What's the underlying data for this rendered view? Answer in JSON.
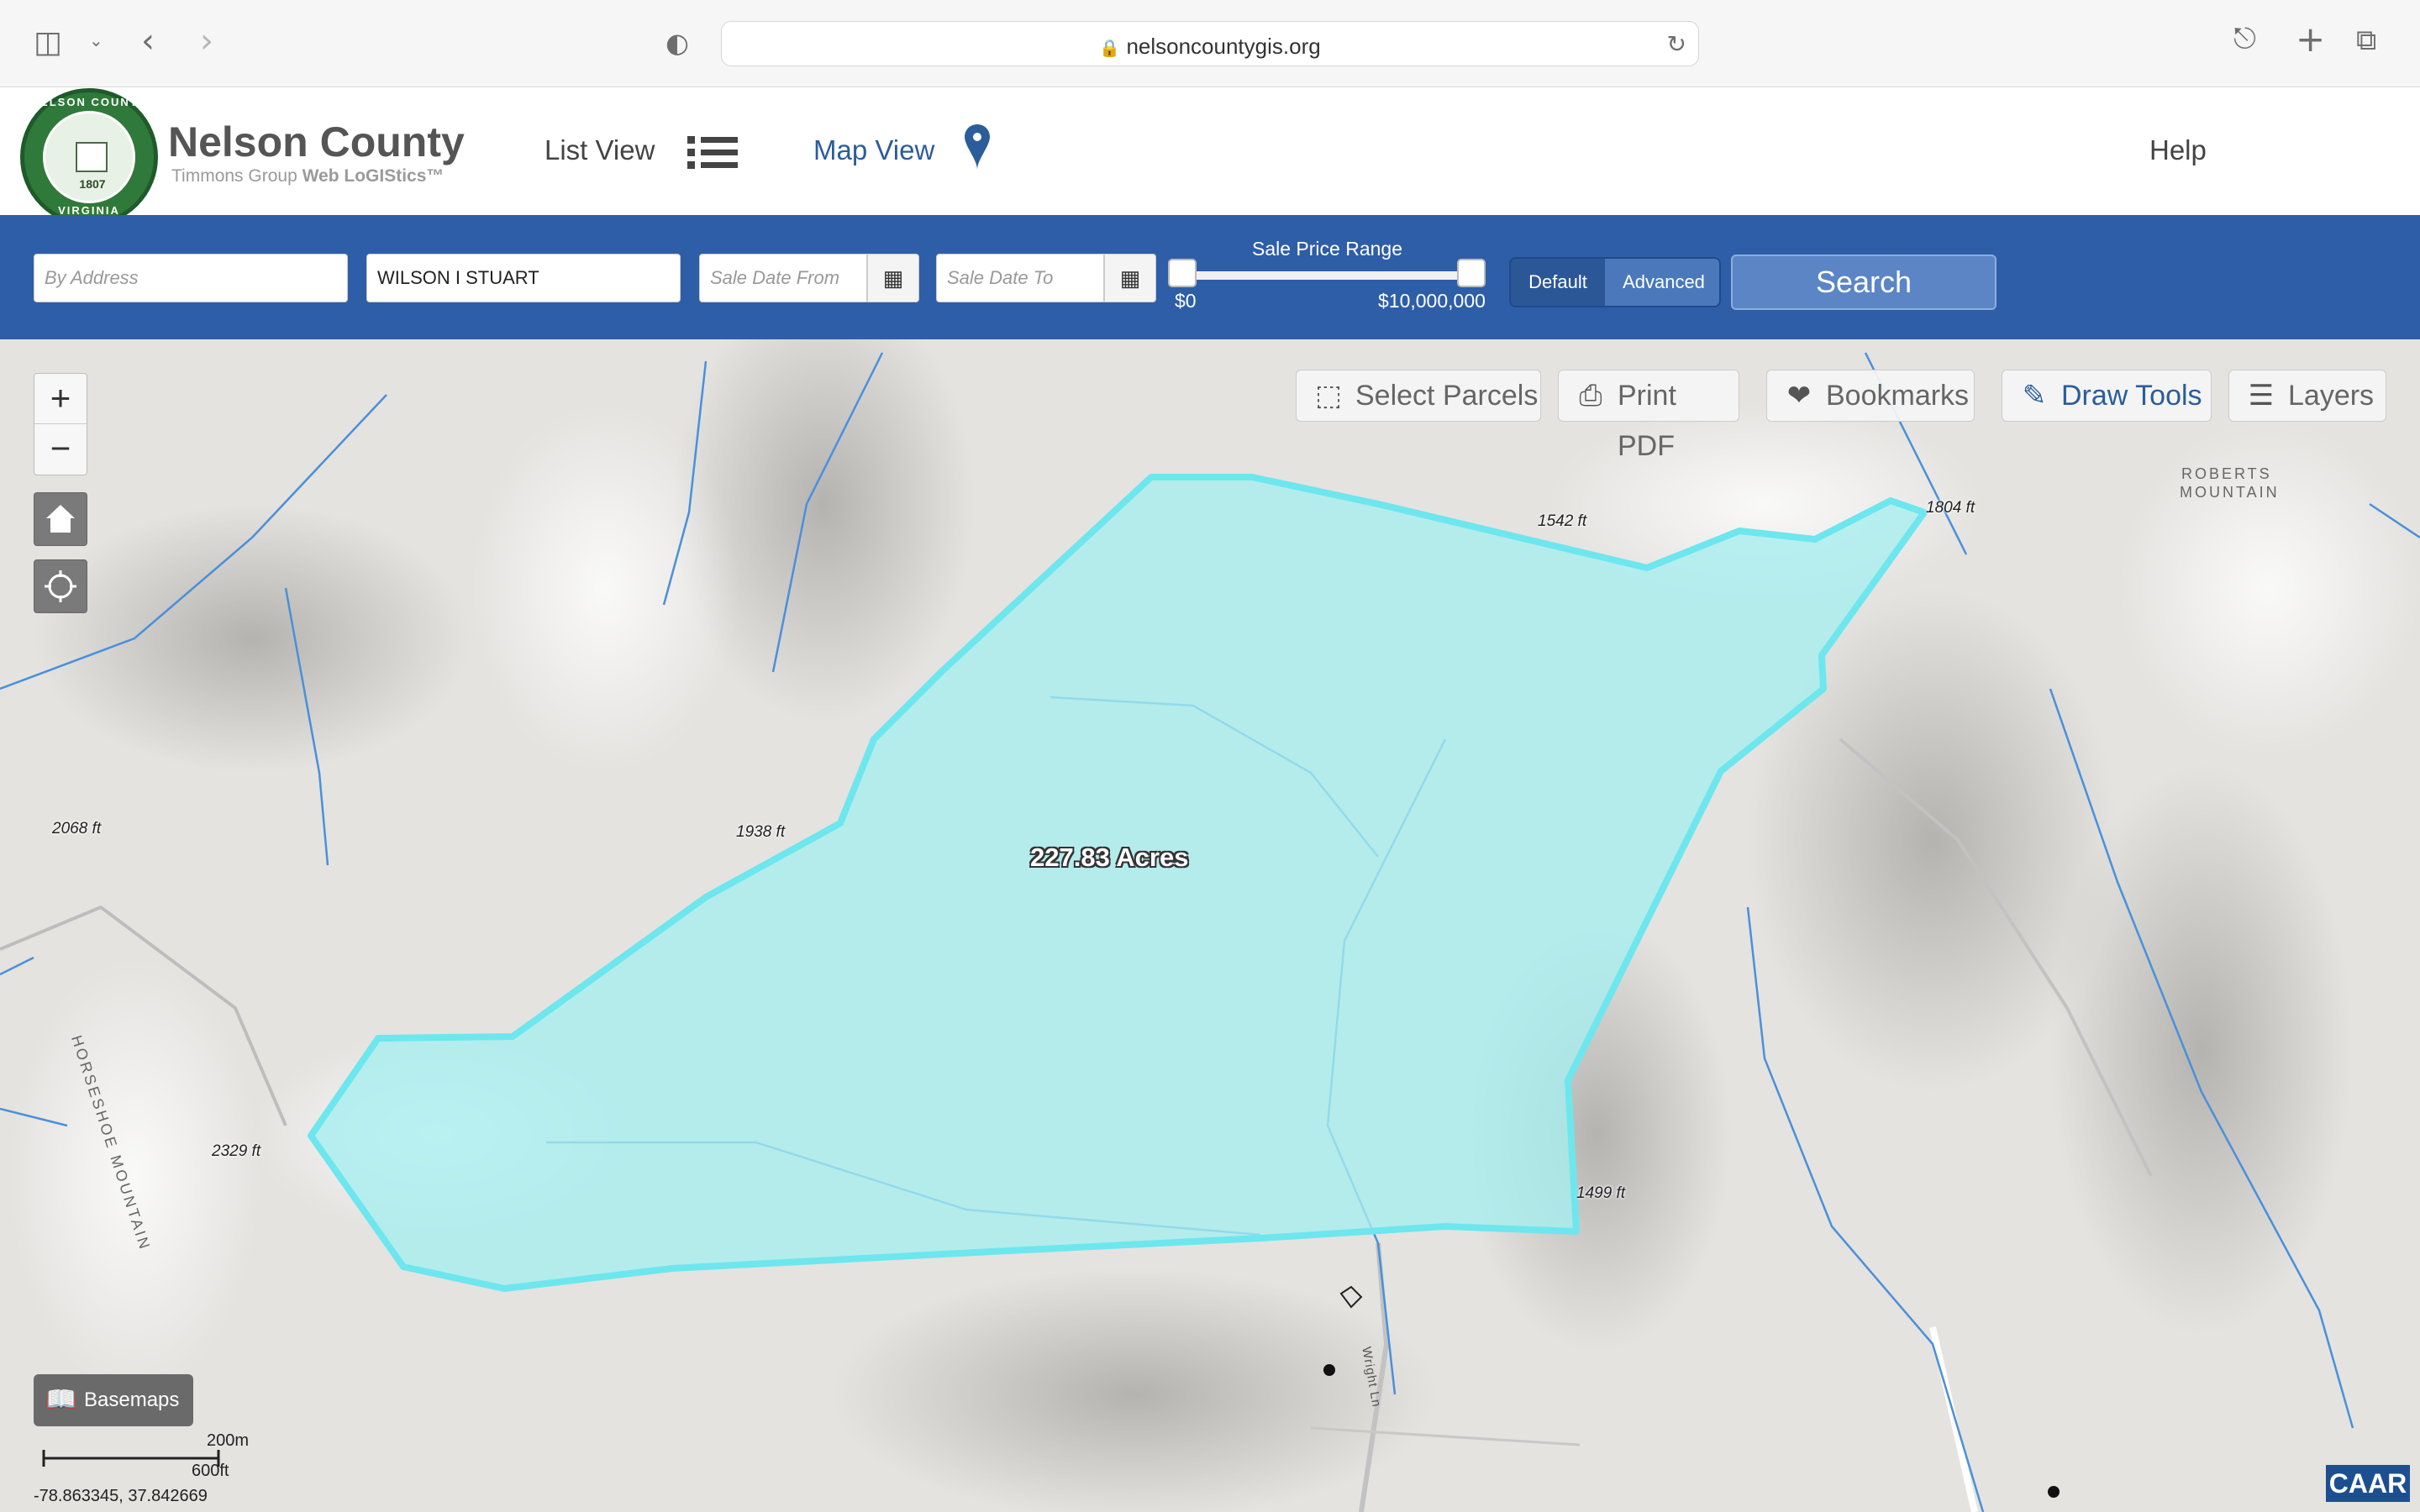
{
  "browser": {
    "url": "nelsoncountygis.org"
  },
  "header": {
    "seal_top": "NELSON COUNTY",
    "seal_bottom": "VIRGINIA",
    "seal_year": "1807",
    "title": "Nelson County",
    "subtitle_prefix": "Timmons Group ",
    "subtitle_bold": "Web LoGIStics™",
    "nav": {
      "list_view": "List View",
      "map_view": "Map View",
      "help": "Help"
    }
  },
  "search": {
    "address_placeholder": "By Address",
    "owner_value": "WILSON I STUART",
    "date_from_placeholder": "Sale Date From",
    "date_to_placeholder": "Sale Date To",
    "price_range_label": "Sale Price Range",
    "price_min": "$0",
    "price_max": "$10,000,000",
    "mode_default": "Default",
    "mode_advanced": "Advanced",
    "search_button": "Search"
  },
  "map": {
    "tools": {
      "select_parcels": "Select Parcels",
      "print_pdf": "Print PDF",
      "bookmarks": "Bookmarks",
      "draw_tools": "Draw Tools",
      "layers": "Layers"
    },
    "parcel_label": "227.83 Acres",
    "elevations": [
      "1542 ft",
      "1804 ft",
      "2068 ft",
      "1938 ft",
      "2329 ft",
      "1499 ft"
    ],
    "mountain_labels": [
      "ROBERTS",
      "MOUNTAIN",
      "HORSESHOE MOUNTAIN"
    ],
    "road_label": "Wright Ln",
    "basemaps": "Basemaps",
    "scale_metric": "200m",
    "scale_imperial": "600ft",
    "coordinates": "-78.863345, 37.842669",
    "attribution": "CAAR",
    "colors": {
      "parcel_fill": "#a6eef0",
      "parcel_outline": "#6ee6ee",
      "stream": "#4a90d9",
      "header_blue": "#2e5ea8"
    }
  }
}
